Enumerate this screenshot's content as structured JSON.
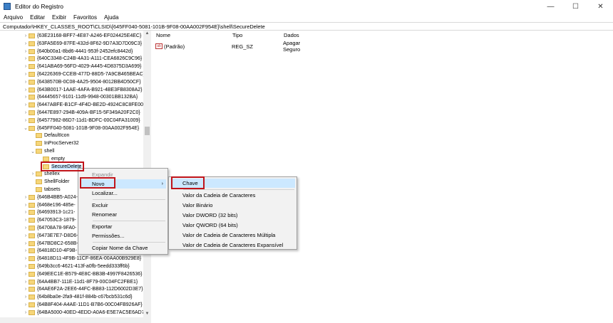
{
  "window": {
    "title": "Editor do Registro",
    "controls": [
      "—",
      "☐",
      "✕"
    ]
  },
  "menubar": [
    "Arquivo",
    "Editar",
    "Exibir",
    "Favoritos",
    "Ajuda"
  ],
  "address": "Computador\\HKEY_CLASSES_ROOT\\CLSID\\{645FF040-5081-101B-9F08-00AA002F954E}\\shell\\SecureDelete",
  "tree": [
    {
      "label": "{63E23168-BFF7-4E87-A246-EF024425E4EC}",
      "indent": 0,
      "folder": true
    },
    {
      "label": "{63FA5E69-87FE-432d-8F62-9D7A3D7D09C3}",
      "indent": 0,
      "folder": true
    },
    {
      "label": "{640b00a1-8bd6-4441-953f-2452efc8442d}",
      "indent": 0,
      "folder": true
    },
    {
      "label": "{640C3348-C24B-4A31-A111-CEA6826C9C96}",
      "indent": 0,
      "folder": true
    },
    {
      "label": "{641ABA69-56FD-4029-A445-4D8375D3A699}",
      "indent": 0,
      "folder": true
    },
    {
      "label": "{64226369-CCEB-477D-88D5-7A9CB465BEAC}",
      "indent": 0,
      "folder": true
    },
    {
      "label": "{6438570B-0C08-4A25-9504-8012BB4D50CF}",
      "indent": 0,
      "folder": true
    },
    {
      "label": "{643B0017-1AAE-4AFA-B921-4BE3FB8308A2}",
      "indent": 0,
      "folder": true
    },
    {
      "label": "{64445657-9101-11d9-9948-00301BB132BA}",
      "indent": 0,
      "folder": true
    },
    {
      "label": "{6447ABFE-B1CF-4F4D-BE2D-4924C8C8FE00}",
      "indent": 0,
      "folder": true
    },
    {
      "label": "{6447E897-294B-409A-BF15-5F349A20F2C0}",
      "indent": 0,
      "folder": true
    },
    {
      "label": "{64577982-86D7-11d1-BDFC-00C04FA31009}",
      "indent": 0,
      "folder": true
    },
    {
      "label": "{645FF040-5081-101B-9F08-00AA002F954E}",
      "indent": 0,
      "folder": true,
      "expanded": true
    },
    {
      "label": "DefaultIcon",
      "indent": 1,
      "folder": true
    },
    {
      "label": "InProcServer32",
      "indent": 1,
      "folder": true
    },
    {
      "label": "shell",
      "indent": 1,
      "folder": true,
      "expanded": true
    },
    {
      "label": "empty",
      "indent": 2,
      "folder": true
    },
    {
      "label": "SecureDelete",
      "indent": 2,
      "folder": true,
      "selected": true
    },
    {
      "label": "shellex",
      "indent": 1,
      "folder": true
    },
    {
      "label": "ShellFolder",
      "indent": 1,
      "folder": true
    },
    {
      "label": "tabsets",
      "indent": 1,
      "folder": true
    },
    {
      "label": "{646B4BB5-A024-",
      "indent": 0,
      "folder": true
    },
    {
      "label": "{6468e196-485e-",
      "indent": 0,
      "folder": true
    },
    {
      "label": "{64693913-1c21-",
      "indent": 0,
      "folder": true
    },
    {
      "label": "{647053C3-1879-",
      "indent": 0,
      "folder": true
    },
    {
      "label": "{64708A78-9FA0-",
      "indent": 0,
      "folder": true
    },
    {
      "label": "{6473E7E7-D8D6-",
      "indent": 0,
      "folder": true
    },
    {
      "label": "{647BD8C2-658B-",
      "indent": 0,
      "folder": true
    },
    {
      "label": "{64818D10-4F9B-",
      "indent": 0,
      "folder": true
    },
    {
      "label": "{64818D11-4F9B-11CF-86EA-00AA00B929E8}",
      "indent": 0,
      "folder": true
    },
    {
      "label": "{649b3cc6-4621-413f-a0fb-5eedd333ff6b}",
      "indent": 0,
      "folder": true
    },
    {
      "label": "{649EEC1E-B579-4E8C-BB3B-4997F8426536}",
      "indent": 0,
      "folder": true
    },
    {
      "label": "{64A4BB7-111E-11d1-8F79-00C04FC2FBE1}",
      "indent": 0,
      "folder": true
    },
    {
      "label": "{64AE6F2A-2EE6-44FC-BB83-112D6002D3E7}",
      "indent": 0,
      "folder": true
    },
    {
      "label": "{64b8ba0e-2fa9-481f-884b-c67bcb531c6d}",
      "indent": 0,
      "folder": true
    },
    {
      "label": "{64B8F404-A4AE-11D1-B7B6-00C04FB926AF}",
      "indent": 0,
      "folder": true
    },
    {
      "label": "{64BA5000-40ED-4EDD-A0A6-E5E7AC5E6AD7E}",
      "indent": 0,
      "folder": true
    }
  ],
  "list": {
    "columns": [
      "Nome",
      "Tipo",
      "Dados"
    ],
    "rows": [
      {
        "icon": "ab",
        "name": "(Padrão)",
        "type": "REG_SZ",
        "data": "Apagar Seguro"
      }
    ]
  },
  "context_menu": {
    "items": [
      "Expandir",
      "Novo",
      "Localizar...",
      "Excluir",
      "Renomear",
      "Exportar",
      "Permissões...",
      "Copiar Nome da Chave"
    ],
    "submenu_arrow": "›"
  },
  "submenu": {
    "items": [
      "Chave",
      "Valor da Cadeia de Caracteres",
      "Valor Binário",
      "Valor DWORD (32 bits)",
      "Valor QWORD (64 bits)",
      "Valor de Cadeia de Caracteres Múltipla",
      "Valor de Cadeia de Caracteres Expansível"
    ]
  },
  "colors": {
    "highlight": "#c0141b",
    "selection": "#cce8ff",
    "folder": "#f6d67a"
  }
}
